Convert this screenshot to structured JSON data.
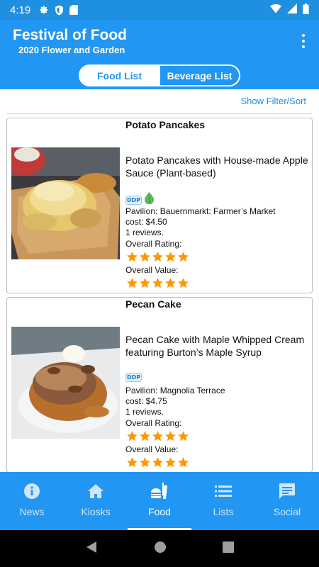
{
  "status_bar": {
    "time": "4:19"
  },
  "app_bar": {
    "title": "Festival of Food",
    "subtitle": "2020 Flower and Garden"
  },
  "segments": {
    "food": "Food List",
    "beverage": "Beverage List"
  },
  "filter_link": "Show Filter/Sort",
  "items": [
    {
      "title": "Potato Pancakes",
      "name": "Potato Pancakes with House-made Apple Sauce (Plant-based)",
      "badge": "DDP",
      "plant_based": true,
      "pavilion": "Pavilion: Bauernmarkt: Farmer’s Market",
      "cost": "cost: $4.50",
      "reviews": "1 reviews.",
      "overall_rating_label": "Overall Rating:",
      "overall_rating": 5,
      "overall_value_label": "Overall Value:",
      "overall_value": 5
    },
    {
      "title": "Pecan Cake",
      "name": "Pecan Cake with Maple Whipped Cream featuring Burton’s Maple Syrup",
      "badge": "DDP",
      "plant_based": false,
      "pavilion": "Pavilion: Magnolia Terrace",
      "cost": "cost: $4.75",
      "reviews": "1 reviews.",
      "overall_rating_label": "Overall Rating:",
      "overall_rating": 5,
      "overall_value_label": "Overall Value:",
      "overall_value": 5
    }
  ],
  "bottom_nav": [
    {
      "label": "News",
      "icon": "info-icon"
    },
    {
      "label": "Kiosks",
      "icon": "home-icon"
    },
    {
      "label": "Food",
      "icon": "fastfood-icon",
      "active": true
    },
    {
      "label": "Lists",
      "icon": "list-icon"
    },
    {
      "label": "Social",
      "icon": "chat-icon"
    }
  ],
  "colors": {
    "primary": "#2196f3",
    "status": "#1f8fe0",
    "star": "#ff9800",
    "leaf": "#5cb85c"
  }
}
